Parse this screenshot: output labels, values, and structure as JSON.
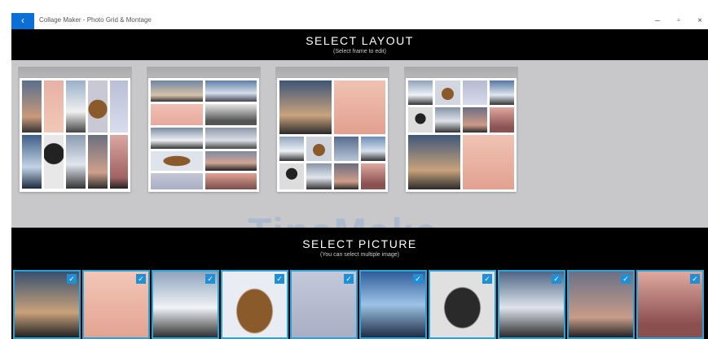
{
  "window": {
    "title": "Collage Maker - Photo Grid & Montage",
    "back_glyph": "‹",
    "minimize_glyph": "–",
    "maximize_glyph": "▫",
    "close_glyph": "×"
  },
  "layout_section": {
    "title": "SELECT LAYOUT",
    "subtitle": "(Select frame to edit)",
    "frames": [
      {
        "name": "layout-1"
      },
      {
        "name": "layout-2"
      },
      {
        "name": "layout-3"
      },
      {
        "name": "layout-4"
      }
    ]
  },
  "picture_section": {
    "title": "SELECT PICTURE",
    "subtitle": "(You can select multiple image)",
    "check_glyph": "✓",
    "thumbnails": [
      {
        "kind": "sunset-sky",
        "selected": true
      },
      {
        "kind": "pink-sky-lamp",
        "selected": true
      },
      {
        "kind": "cloud-tree",
        "selected": true
      },
      {
        "kind": "basket",
        "selected": true
      },
      {
        "kind": "snow",
        "selected": true
      },
      {
        "kind": "sea-horizon",
        "selected": true
      },
      {
        "kind": "basket-bw",
        "selected": true
      },
      {
        "kind": "cloud-sky",
        "selected": true
      },
      {
        "kind": "dusk-pole",
        "selected": true
      },
      {
        "kind": "sunset-trees",
        "selected": true
      }
    ]
  },
  "watermark": "TipsMake",
  "colors": {
    "accent": "#0b6fd6",
    "selection_border": "#2aa3d6",
    "layout_bg": "#c8c8cb"
  }
}
